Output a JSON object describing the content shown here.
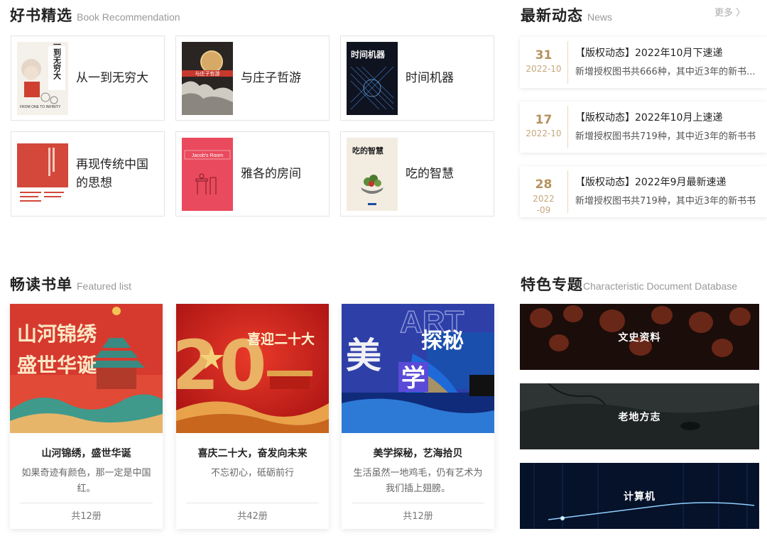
{
  "book_section": {
    "title_cn": "好书精选",
    "title_en": "Book Recommendation",
    "books": [
      {
        "name": "从一到无穷大",
        "cover_color": "#f4f0ea"
      },
      {
        "name": "与庄子哲游",
        "cover_color": "#2a2522"
      },
      {
        "name": "时间机器",
        "cover_color": "#0f1320"
      },
      {
        "name": "再现传统中国的思想",
        "cover_color": "#d3483a"
      },
      {
        "name": "雅各的房间",
        "cover_color": "#ea4a5d"
      },
      {
        "name": "吃的智慧",
        "cover_color": "#f3ede1"
      }
    ],
    "cover_text": {
      "b1": "从一到无穷大",
      "b1_en": "FROM ONE TO INFINITY",
      "b2": "与庄子哲游",
      "b3": "时间机器",
      "b5": "Jacob's Room",
      "b6": "吃的智慧"
    }
  },
  "news_section": {
    "title_cn": "最新动态",
    "title_en": "News",
    "more_label": "更多 〉",
    "items": [
      {
        "day": "31",
        "ym": "2022-10",
        "title": "【版权动态】2022年10月下速递",
        "desc": "新增授权图书共666种，其中近3年的新书..."
      },
      {
        "day": "17",
        "ym": "2022-10",
        "title": "【版权动态】2022年10月上速递",
        "desc": "新增授权图书共719种，其中近3年的新书书"
      },
      {
        "day": "28",
        "ym": "2022-09",
        "title": "【版权动态】2022年9月最新速递",
        "desc": "新增授权图书共719种，其中近3年的新书书"
      }
    ]
  },
  "featured_section": {
    "title_cn": "畅读书单",
    "title_en": "Featured list",
    "cards": [
      {
        "title": "山河锦绣，盛世华诞",
        "desc": "如果奇迹有颜色，那一定是中国红。",
        "count": "共12册",
        "banner_text_1": "山河锦绣",
        "banner_text_2": "盛世华诞"
      },
      {
        "title": "喜庆二十大，奋发向未来",
        "desc": "不忘初心，砥砺前行",
        "count": "共42册",
        "banner_text_1": "喜迎二十大",
        "banner_text_2": "20"
      },
      {
        "title": "美学探秘，艺海拾贝",
        "desc": "生活虽然一地鸡毛，仍有艺术为我们插上翅膀。",
        "count": "共12册",
        "banner_text_1": "美",
        "banner_text_2": "学",
        "banner_text_3": "探秘",
        "banner_text_4": "ART"
      }
    ]
  },
  "topic_section": {
    "title_cn": "特色专题",
    "title_en": "Characteristic Document Database",
    "topics": [
      {
        "label": "文史资料"
      },
      {
        "label": "老地方志"
      },
      {
        "label": "计算机"
      }
    ]
  },
  "colors": {
    "accent_gold": "#b6925d",
    "china_red": "#d8302a",
    "art_blue": "#2e3fa8"
  }
}
